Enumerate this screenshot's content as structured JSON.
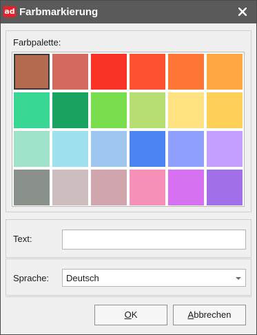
{
  "window": {
    "title": "Farbmarkierung",
    "logo_text": "ad",
    "logo_color": "#e8202a",
    "titlebar_color": "#5a5a5a"
  },
  "palette": {
    "label": "Farbpalette:",
    "selected_index": 0,
    "colors": [
      "#b36b50",
      "#d4695e",
      "#f93426",
      "#ff5233",
      "#ff7637",
      "#ffa843",
      "#37d692",
      "#1aa360",
      "#78de4d",
      "#b6de72",
      "#ffe382",
      "#ffd057",
      "#9fe2c7",
      "#9ee1ef",
      "#9ec7ef",
      "#4c84f1",
      "#8f9ffd",
      "#c49fff",
      "#89918a",
      "#cdbdbf",
      "#d1a5ae",
      "#f690b8",
      "#d671f1",
      "#a16fe8"
    ]
  },
  "text_field": {
    "label": "Text:",
    "value": ""
  },
  "language": {
    "label": "Sprache:",
    "selected": "Deutsch"
  },
  "buttons": {
    "ok_label": "OK",
    "cancel_label": "Abbrechen"
  }
}
